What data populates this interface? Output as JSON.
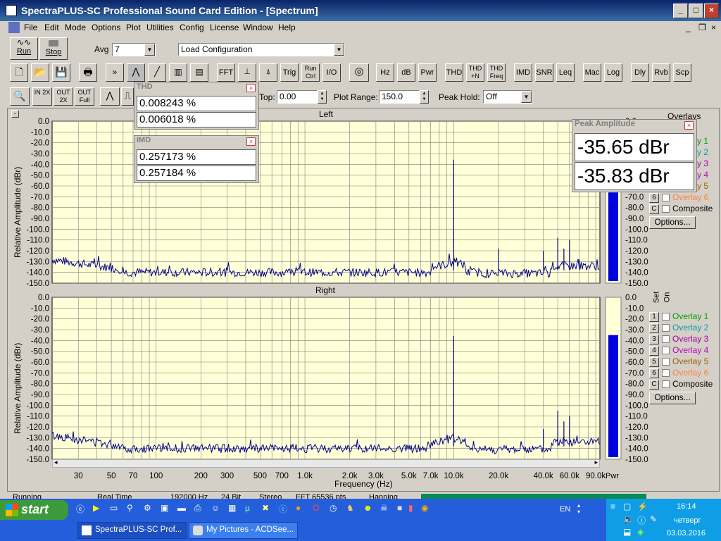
{
  "window": {
    "title": "SpectraPLUS-SC Professional Sound Card Edition - [Spectrum]"
  },
  "menu": [
    "File",
    "Edit",
    "Mode",
    "Options",
    "Plot",
    "Utilities",
    "Config",
    "License",
    "Window",
    "Help"
  ],
  "toolbar1": {
    "run": "Run",
    "stop": "Stop",
    "avg_label": "Avg",
    "avg_value": "7",
    "config": "Load Configuration"
  },
  "toolbar2": [
    "FFT",
    "Trig",
    "Run Ctrl",
    "I/O",
    "Hz",
    "dB",
    "Pwr",
    "THD",
    "THD +N",
    "THD Freq",
    "IMD",
    "SNR",
    "Leq",
    "Mac",
    "Log",
    "Dly",
    "Rvb",
    "Scp"
  ],
  "toolbar3": {
    "zoom_in": "IN 2X",
    "zoom_out": "OUT 2X",
    "zoom_full": "OUT Full",
    "top_label": "Top:",
    "top_value": "0.00",
    "range_label": "Plot Range:",
    "range_value": "150.0",
    "peak_label": "Peak Hold:",
    "peak_value": "Off"
  },
  "thd": {
    "title": "THD",
    "v1": "0.008243 %",
    "v2": "0.006018 %"
  },
  "imd": {
    "title": "IMD",
    "v1": "0.257173 %",
    "v2": "0.257184 %"
  },
  "peak": {
    "title": "Peak Amplitude",
    "v1": "-35.65 dBr",
    "v2": "-35.83 dBr"
  },
  "plots": {
    "left_title": "Left",
    "right_title": "Right",
    "ylabel": "Relative Amplitude (dBr)",
    "yticks": [
      "0.0",
      "-10.0",
      "-20.0",
      "-30.0",
      "-40.0",
      "-50.0",
      "-60.0",
      "-70.0",
      "-80.0",
      "-90.0",
      "-100.0",
      "-110.0",
      "-120.0",
      "-130.0",
      "-140.0",
      "-150.0"
    ],
    "xticks": [
      "30",
      "50",
      "70",
      "100",
      "200",
      "300",
      "500",
      "700",
      "1.0k",
      "2.0k",
      "3.0k",
      "5.0k",
      "7.0k",
      "10.0k",
      "20.0k",
      "40.0k",
      "60.0k",
      "90.0k"
    ],
    "xlabel": "Frequency (Hz)",
    "pwr": "Pwr"
  },
  "overlays": {
    "header": "Overlays",
    "set": "Set",
    "on": "On",
    "items": [
      {
        "n": "1",
        "label": "Overlay 1",
        "color": "#00a000"
      },
      {
        "n": "2",
        "label": "Overlay 2",
        "color": "#00a0a0"
      },
      {
        "n": "3",
        "label": "Overlay 3",
        "color": "#a000a0"
      },
      {
        "n": "4",
        "label": "Overlay 4",
        "color": "#c000c0"
      },
      {
        "n": "5",
        "label": "Overlay 5",
        "color": "#a06000"
      },
      {
        "n": "6",
        "label": "Overlay 6",
        "color": "#ff8040"
      },
      {
        "n": "C",
        "label": "Composite",
        "color": "#000000"
      }
    ],
    "top_partial": [
      "y 1",
      "y 2",
      "y 3",
      "y 4",
      "y 5"
    ],
    "options": "Options..."
  },
  "status": [
    "Running",
    "Real Time",
    "192000 Hz",
    "24 Bit",
    "Stereo",
    "FFT 65536 pts",
    "Hanning"
  ],
  "taskbar": {
    "start": "start",
    "items": [
      "SpectraPLUS-SC Prof...",
      "My Pictures - ACDSee..."
    ],
    "lang": "EN",
    "time": "16:14",
    "day": "четверг",
    "date": "03.03.2016"
  },
  "colors": {
    "trace": "#00008b",
    "plotbg": "#ffffd8",
    "grid": "#808080",
    "bar": "#0000e0"
  },
  "chart_data": {
    "type": "line",
    "xscale": "log",
    "xlim": [
      20,
      96000
    ],
    "ylim": [
      -150,
      0
    ],
    "series": [
      {
        "peaks_hz": [
          10000,
          20000,
          40000,
          50000,
          55000,
          60000,
          70000
        ],
        "peaks_dbr": [
          -35.65,
          -118,
          -120,
          -108,
          -118,
          -110,
          -128
        ]
      },
      {
        "peaks_hz": [
          10000,
          40000,
          50000,
          55000,
          60000
        ],
        "peaks_dbr": [
          -35.83,
          -122,
          -105,
          -115,
          -110
        ]
      }
    ]
  }
}
